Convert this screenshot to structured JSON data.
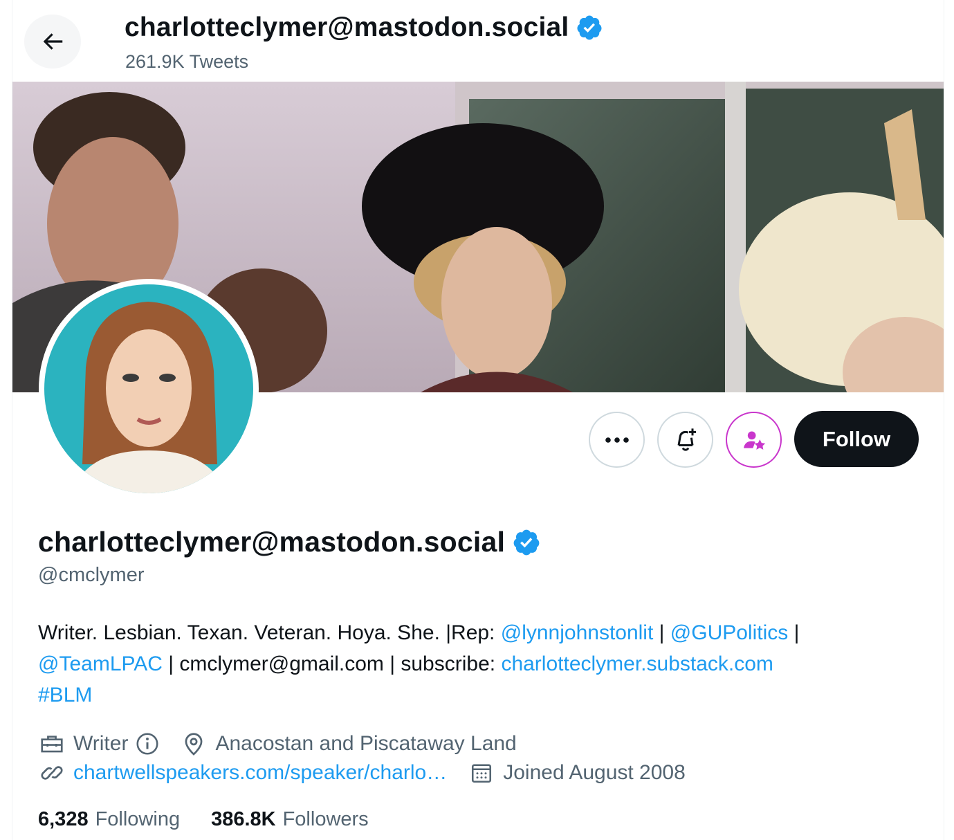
{
  "header": {
    "title": "charlotteclymer@mastodon.social",
    "tweet_count": "261.9K Tweets"
  },
  "profile": {
    "display_name": "charlotteclymer@mastodon.social",
    "handle": "@cmclymer",
    "verified": true,
    "bio": {
      "l1_text1": "Writer. Lesbian. Texan. Veteran. Hoya. She. |Rep: ",
      "l1_link1": "@lynnjohnstonlit",
      "l1_sep1": " | ",
      "l1_link2": "@GUPolitics",
      "l1_sep2": " |",
      "l2_link1": "@TeamLPAC",
      "l2_text1": " | cmclymer@gmail.com | subscribe: ",
      "l2_link2": "charlotteclymer.substack.com",
      "l3_link1": "#BLM"
    },
    "profession": "Writer",
    "location": "Anacostan and Piscataway Land",
    "website": "chartwellspeakers.com/speaker/charlo…",
    "joined": "Joined August 2008"
  },
  "stats": {
    "following_count": "6,328",
    "following_label": "Following",
    "followers_count": "386.8K",
    "followers_label": "Followers"
  },
  "actions": {
    "follow_label": "Follow"
  },
  "colors": {
    "link": "#1d9bf0",
    "verified": "#1d9bf0",
    "super_follow": "#c936cc",
    "follow_bg": "#0f1419"
  }
}
